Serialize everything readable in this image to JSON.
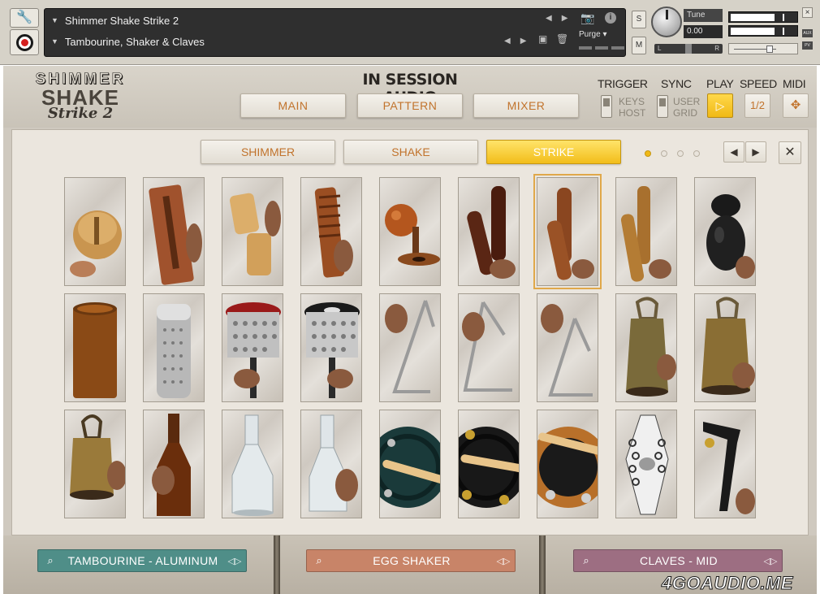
{
  "header": {
    "instrument_name": "Shimmer Shake Strike 2",
    "multi_name": "Tambourine, Shaker & Claves",
    "purge_label": "Purge",
    "solo_label": "S",
    "mute_label": "M",
    "tune_label": "Tune",
    "tune_value": "0.00",
    "pan_left": "L",
    "pan_right": "R",
    "close_glyph": "×",
    "aux_label": "AUX",
    "pv_label": "PV"
  },
  "instrument": {
    "logo": {
      "line1": "SHIMMER",
      "line2": "SHAKE",
      "line3": "Strike 2"
    },
    "brand": "IN SESSION AUDIO",
    "main_tabs": [
      {
        "label": "MAIN"
      },
      {
        "label": "PATTERN"
      },
      {
        "label": "MIXER"
      }
    ],
    "trigger": {
      "label": "TRIGGER",
      "opt1": "KEYS",
      "opt2": "HOST"
    },
    "sync": {
      "label": "SYNC",
      "opt1": "USER",
      "opt2": "GRID"
    },
    "play": {
      "label": "PLAY",
      "glyph": "▷"
    },
    "speed": {
      "label": "SPEED",
      "value": "1/2"
    },
    "midi": {
      "label": "MIDI",
      "glyph": "✥"
    },
    "sub_tabs": [
      {
        "label": "SHIMMER",
        "active": false
      },
      {
        "label": "SHAKE",
        "active": false
      },
      {
        "label": "STRIKE",
        "active": true
      }
    ],
    "page_dots": {
      "count": 4,
      "active_index": 0
    },
    "nav": {
      "prev": "◀",
      "next": "▶",
      "close": "✕"
    },
    "selected_tile": 6,
    "tiles": [
      "woodblock-bell",
      "slit-drum",
      "wood-tone",
      "guiro-block",
      "wood-ball-clapper",
      "claves-dark",
      "claves-mid",
      "claves-light",
      "castanets",
      "wood-cylinder",
      "metal-guiro",
      "red-cabasa",
      "black-cabasa",
      "triangle-a",
      "triangle-b",
      "triangle-c",
      "cowbell-small",
      "cowbell-large",
      "bell-small",
      "beer-bottle",
      "glass-bottle-a",
      "glass-bottle-b",
      "tambourine-black",
      "tambourine-brass",
      "tambourine-aluminum",
      "chain-shaker",
      "metal-clapper"
    ]
  },
  "footer": {
    "slots": [
      {
        "label": "TAMBOURINE - ALUMINUM",
        "color": "#4f8e88"
      },
      {
        "label": "EGG SHAKER",
        "color": "#c88468"
      },
      {
        "label": "CLAVES - MID",
        "color": "#9d6e82"
      }
    ],
    "arrow_glyph": "◁▷"
  },
  "watermark": "4GOAUDIO.ME",
  "colors": {
    "accent_orange": "#c1732c",
    "active_yellow": "#f2bd1a"
  }
}
